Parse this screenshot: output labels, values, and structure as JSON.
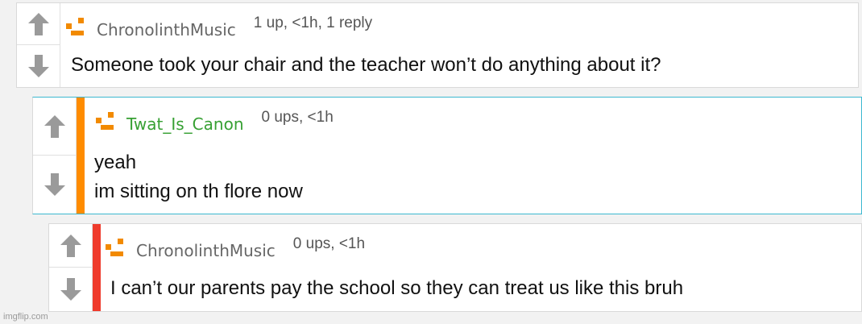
{
  "comments": [
    {
      "username": "ChronolinthMusic",
      "stats": "1 up, <1h, 1 reply",
      "lines": [
        "Someone took your chair and the teacher won’t do anything about it?"
      ]
    },
    {
      "username": "Twat_Is_Canon",
      "stats": "0 ups, <1h",
      "lines": [
        "yeah",
        "im sitting on th flore now"
      ],
      "stripe_color": "#ff8c00",
      "username_color": "#37a033"
    },
    {
      "username": "ChronolinthMusic",
      "stats": "0 ups, <1h",
      "lines": [
        "I can’t our parents pay the school so they can treat us like this bruh"
      ],
      "stripe_color": "#ef3b2c"
    }
  ],
  "icons": {
    "upvote": "upvote-arrow-icon",
    "downvote": "downvote-arrow-icon",
    "avatar": "default-avatar-icon"
  },
  "watermark": "imgflip.com"
}
